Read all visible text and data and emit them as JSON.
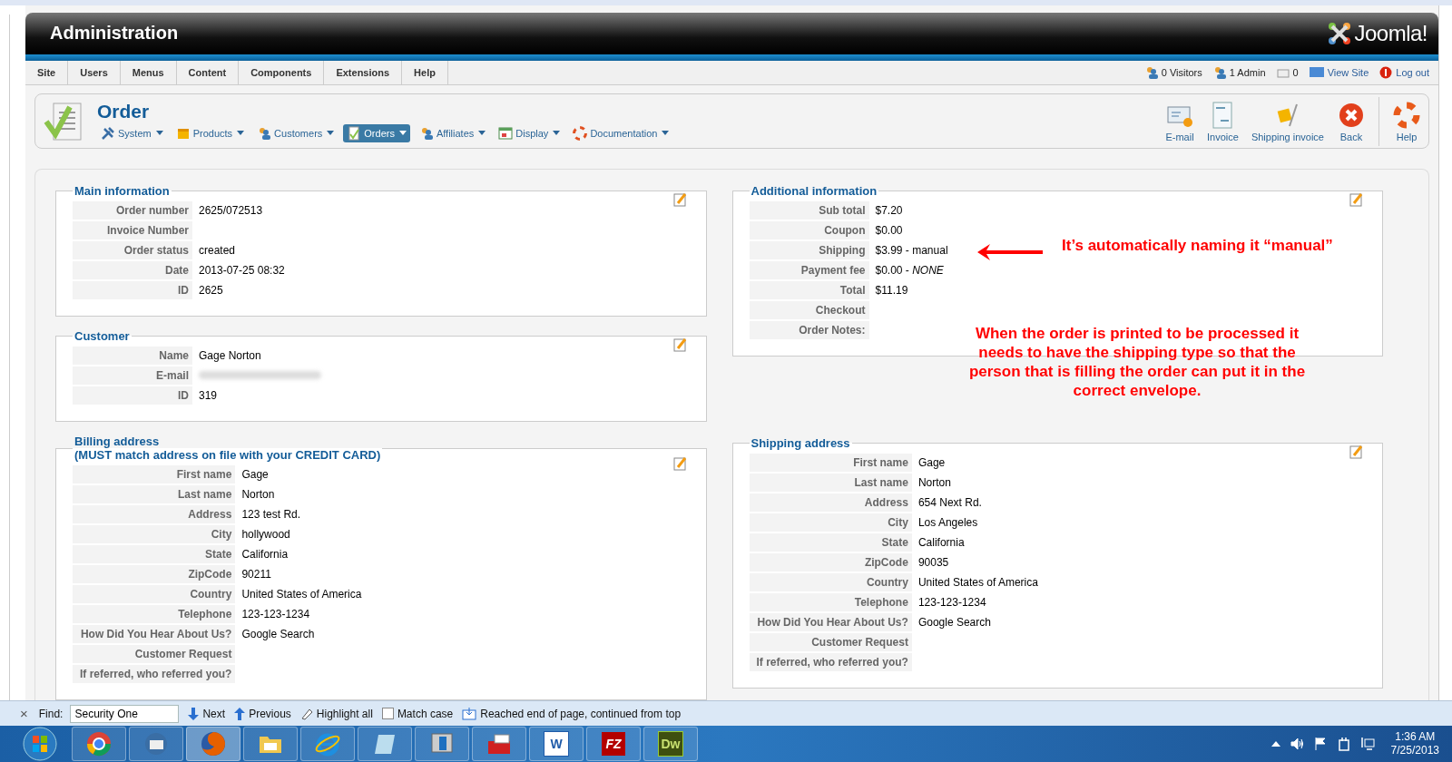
{
  "header": {
    "title": "Administration",
    "brand": "Joomla!"
  },
  "menu": [
    {
      "label": "Site"
    },
    {
      "label": "Users"
    },
    {
      "label": "Menus"
    },
    {
      "label": "Content"
    },
    {
      "label": "Components"
    },
    {
      "label": "Extensions"
    },
    {
      "label": "Help"
    }
  ],
  "status_links": [
    {
      "kind": "visitors",
      "text": "0 Visitors"
    },
    {
      "kind": "admin",
      "text": "1 Admin"
    },
    {
      "kind": "messages",
      "text": "0"
    },
    {
      "kind": "view-site",
      "text": "View Site"
    },
    {
      "kind": "logout",
      "text": "Log out"
    }
  ],
  "page_title": "Order",
  "submenu": [
    {
      "kind": "system",
      "label": "System",
      "selected": false
    },
    {
      "kind": "products",
      "label": "Products",
      "selected": false
    },
    {
      "kind": "customers",
      "label": "Customers",
      "selected": false
    },
    {
      "kind": "orders",
      "label": "Orders",
      "selected": true
    },
    {
      "kind": "affiliates",
      "label": "Affiliates",
      "selected": false
    },
    {
      "kind": "display",
      "label": "Display",
      "selected": false
    },
    {
      "kind": "documentation",
      "label": "Documentation",
      "selected": false
    }
  ],
  "toolbar": [
    {
      "kind": "email",
      "label": "E-mail"
    },
    {
      "kind": "invoice",
      "label": "Invoice"
    },
    {
      "kind": "shipping",
      "label": "Shipping invoice"
    },
    {
      "kind": "back",
      "label": "Back"
    },
    {
      "kind": "help",
      "label": "Help"
    }
  ],
  "left_sections": [
    {
      "title": "Main information",
      "rows": [
        {
          "label": "Order number",
          "value": "2625/072513"
        },
        {
          "label": "Invoice Number"
        },
        {
          "label": "Order status",
          "value": "created"
        },
        {
          "label": "Date",
          "value": "2013-07-25 08:32"
        },
        {
          "label": "ID",
          "value": "2625"
        }
      ]
    },
    {
      "title": "Customer",
      "rows": [
        {
          "label": "Name",
          "value": "Gage Norton"
        },
        {
          "label": "E-mail",
          "blurred": true
        },
        {
          "label": "ID",
          "value": "319"
        }
      ]
    },
    {
      "title": "Billing address",
      "subtitle": "(MUST match address on file with your CREDIT CARD)",
      "rows": [
        {
          "label": "First name",
          "value": "Gage"
        },
        {
          "label": "Last name",
          "value": "Norton"
        },
        {
          "label": "Address",
          "value": "123 test Rd."
        },
        {
          "label": "City",
          "value": "hollywood"
        },
        {
          "label": "State",
          "value": "California"
        },
        {
          "label": "ZipCode",
          "value": "90211"
        },
        {
          "label": "Country",
          "value": "United States of America"
        },
        {
          "label": "Telephone",
          "value": "123-123-1234"
        },
        {
          "label": "How Did You Hear About Us?",
          "value": "Google Search"
        },
        {
          "label": "Customer Request"
        },
        {
          "label": "If referred, who referred you?"
        }
      ]
    }
  ],
  "right_sections": [
    {
      "title": "Additional information",
      "rows": [
        {
          "label": "Sub total",
          "value": "$7.20"
        },
        {
          "label": "Coupon",
          "value": "$0.00"
        },
        {
          "label": "Shipping",
          "value": "$3.99 - manual"
        },
        {
          "label": "Payment fee",
          "value": "$0.00 - *NONE*"
        },
        {
          "label": "Total",
          "value": "$11.19"
        },
        {
          "label": "Checkout"
        },
        {
          "label": "Order Notes:"
        }
      ]
    },
    {
      "title": "Shipping address",
      "rows": [
        {
          "label": "First name",
          "value": "Gage"
        },
        {
          "label": "Last name",
          "value": "Norton"
        },
        {
          "label": "Address",
          "value": "654 Next Rd."
        },
        {
          "label": "City",
          "value": "Los Angeles"
        },
        {
          "label": "State",
          "value": "California"
        },
        {
          "label": "ZipCode",
          "value": "90035"
        },
        {
          "label": "Country",
          "value": "United States of America"
        },
        {
          "label": "Telephone",
          "value": "123-123-1234"
        },
        {
          "label": "How Did You Hear About Us?",
          "value": "Google Search"
        },
        {
          "label": "Customer Request"
        },
        {
          "label": "If referred, who referred you?"
        }
      ]
    }
  ],
  "annotations": [
    {
      "text": "It’s automatically naming it “manual”"
    },
    {
      "text": "When the order is printed to be processed it needs to have the shipping type so that the person that is filling the order can put it in the correct envelope."
    }
  ],
  "find_bar": {
    "close": "×",
    "label": "Find:",
    "value": "Security One",
    "next": "Next",
    "previous": "Previous",
    "highlight": "Highlight all",
    "match_case": {
      "label": "Match case",
      "checked": false
    },
    "message": "Reached end of page, continued from top"
  },
  "taskbar": [
    {
      "kind": "chrome",
      "active": false
    },
    {
      "kind": "mail",
      "active": false
    },
    {
      "kind": "firefox",
      "active": true
    },
    {
      "kind": "folder",
      "active": false
    },
    {
      "kind": "ie",
      "active": false
    },
    {
      "kind": "notepad",
      "active": false
    },
    {
      "kind": "monitor",
      "active": false
    },
    {
      "kind": "toolbox",
      "active": false
    },
    {
      "kind": "word",
      "label": "W",
      "active": false
    },
    {
      "kind": "filezilla",
      "label": "FZ",
      "active": false
    },
    {
      "kind": "dreamweaver",
      "label": "Dw",
      "active": false
    }
  ],
  "clock": {
    "time": "1:36 AM",
    "date": "7/25/2013"
  }
}
